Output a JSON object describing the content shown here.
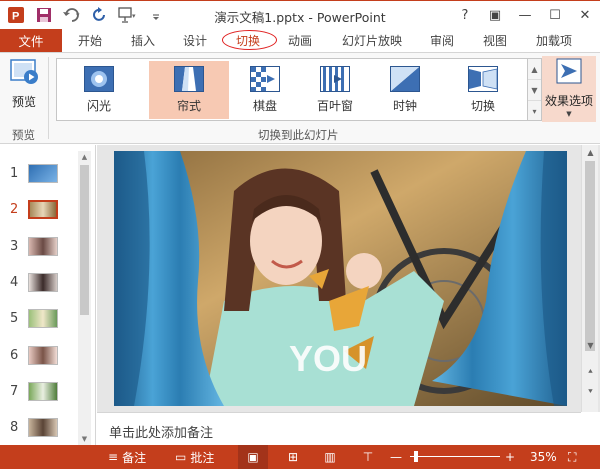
{
  "window": {
    "title": "演示文稿1.pptx - PowerPoint",
    "controls": [
      "?",
      "▣",
      "—",
      "☐",
      "✕"
    ]
  },
  "qat": [
    "powerpoint-logo-icon",
    "save-icon",
    "undo-icon",
    "redo-icon",
    "start-slideshow-icon",
    "customize-qat-icon"
  ],
  "tabs": {
    "file": "文件",
    "items": [
      "开始",
      "插入",
      "设计",
      "切换",
      "动画",
      "幻灯片放映",
      "审阅",
      "视图",
      "加载项"
    ],
    "active": "切换"
  },
  "ribbon": {
    "preview": {
      "label": "预览",
      "group": "预览"
    },
    "transitions": {
      "group": "切换到此幻灯片",
      "items": [
        {
          "name": "闪光",
          "icon": "flash-transition-icon"
        },
        {
          "name": "帘式",
          "icon": "curtains-transition-icon",
          "selected": true
        },
        {
          "name": "棋盘",
          "icon": "checkerboard-transition-icon"
        },
        {
          "name": "百叶窗",
          "icon": "blinds-transition-icon"
        },
        {
          "name": "时钟",
          "icon": "clock-transition-icon"
        },
        {
          "name": "切换",
          "icon": "switch-transition-icon"
        }
      ]
    },
    "effects": {
      "label": "效果选项"
    }
  },
  "slides": {
    "numbers": [
      "1",
      "2",
      "3",
      "4",
      "5",
      "6",
      "7",
      "8"
    ],
    "selected": "2"
  },
  "notes": {
    "placeholder": "单击此处添加备注"
  },
  "status": {
    "notes": "备注",
    "comments": "批注",
    "zoom": "35%"
  },
  "colors": {
    "accent": "#c43e1c",
    "selected_gallery": "#f7c9b3",
    "annotation_red": "#e02020"
  }
}
